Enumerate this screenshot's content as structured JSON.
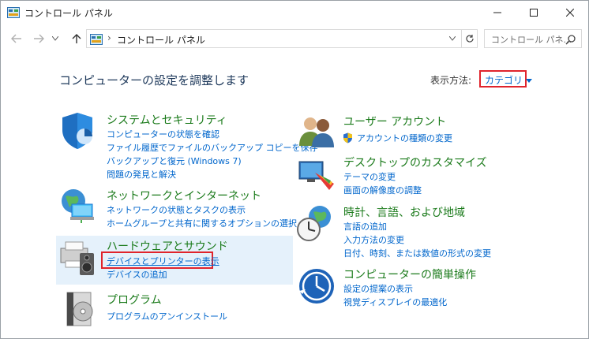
{
  "window": {
    "title": "コントロール パネル"
  },
  "address": {
    "separator": "›",
    "path": "コントロール パネル",
    "search_placeholder": "コントロール パネ..."
  },
  "main": {
    "heading": "コンピューターの設定を調整します",
    "view_label": "表示方法:",
    "view_value": "カテゴリ"
  },
  "categories": [
    {
      "title": "システムとセキュリティ",
      "links": [
        "コンピューターの状態を確認",
        "ファイル履歴でファイルのバックアップ コピーを保存",
        "バックアップと復元 (Windows 7)",
        "問題の発見と解決"
      ]
    },
    {
      "title": "ネットワークとインターネット",
      "links": [
        "ネットワークの状態とタスクの表示",
        "ホームグループと共有に関するオプションの選択"
      ]
    },
    {
      "title": "ハードウェアとサウンド",
      "links": [
        "デバイスとプリンターの表示",
        "デバイスの追加"
      ]
    },
    {
      "title": "プログラム",
      "links": [
        "プログラムのアンインストール"
      ]
    },
    {
      "title": "ユーザー アカウント",
      "links": [
        "アカウントの種類の変更"
      ]
    },
    {
      "title": "デスクトップのカスタマイズ",
      "links": [
        "テーマの変更",
        "画面の解像度の調整"
      ]
    },
    {
      "title": "時計、言語、および地域",
      "links": [
        "言語の追加",
        "入力方法の変更",
        "日付、時刻、または数値の形式の変更"
      ]
    },
    {
      "title": "コンピューターの簡単操作",
      "links": [
        "設定の提案の表示",
        "視覚ディスプレイの最適化"
      ]
    }
  ],
  "colors": {
    "title_green": "#1a7a1a",
    "link_blue": "#0066cc",
    "highlight_red": "#e0242c",
    "heading_blue": "#1e395b"
  }
}
